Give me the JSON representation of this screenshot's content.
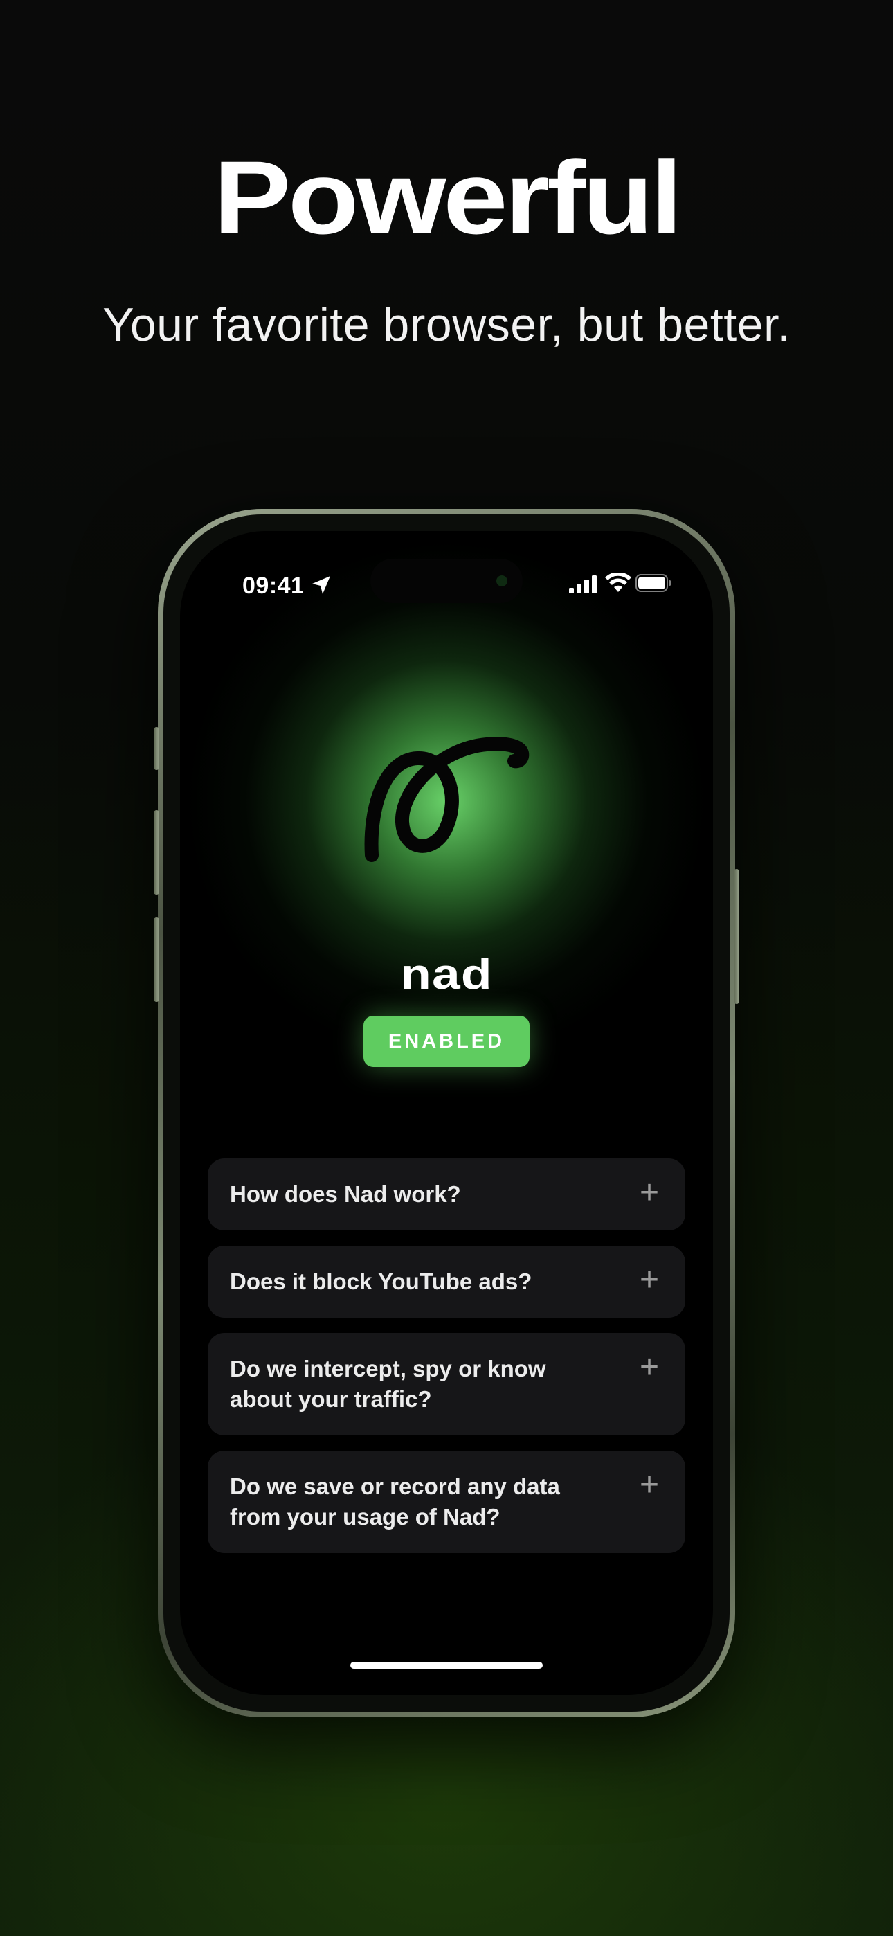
{
  "headline": "Powerful",
  "subheadline": "Your favorite browser, but better.",
  "status_bar": {
    "time": "09:41"
  },
  "app": {
    "name": "nad",
    "status": "ENABLED"
  },
  "faq": [
    {
      "question": "How does Nad work?"
    },
    {
      "question": "Does it block YouTube ads?"
    },
    {
      "question": "Do we intercept, spy or know about your traffic?"
    },
    {
      "question": "Do we save or record any data from your usage of Nad?"
    }
  ],
  "icons": {
    "location": "location-arrow-icon",
    "signal": "cellular-signal-icon",
    "wifi": "wifi-icon",
    "battery": "battery-icon",
    "expand": "plus-icon",
    "logo": "nad-loop-logo-icon"
  },
  "colors": {
    "accent": "#5fcc60",
    "card": "#161618",
    "glow": "#6edc6e"
  }
}
